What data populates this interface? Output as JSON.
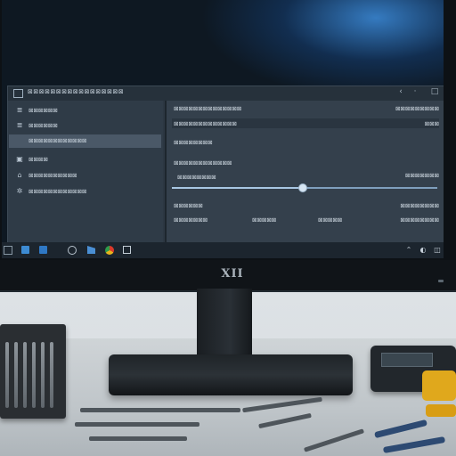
{
  "window": {
    "title": "⊠⊠⊠⊠⊠⊠⊠⊠⊠⊠⊠⊠⊠⊠⊠⊠⊠",
    "controls": [
      "‹",
      "·",
      "□"
    ]
  },
  "sidebar": {
    "items": [
      {
        "icon": "≣",
        "label": "⊠⊠⊠⊠⊠⊠",
        "active": false
      },
      {
        "icon": "≣",
        "label": "⊠⊠⊠⊠⊠⊠",
        "active": false
      },
      {
        "icon": "",
        "label": "⊠⊠⊠⊠⊠⊠⊠⊠⊠⊠⊠⊠",
        "active": true
      },
      {
        "icon": "▣",
        "label": "⊠⊠⊠⊠",
        "active": false
      },
      {
        "icon": "⌂",
        "label": "⊠⊠⊠⊠⊠⊠⊠⊠⊠⊠",
        "active": false
      },
      {
        "icon": "✲",
        "label": "⊠⊠⊠⊠⊠⊠⊠⊠⊠⊠⊠⊠",
        "active": false
      }
    ]
  },
  "content": {
    "heading": "⊠⊠⊠⊠⊠⊠⊠⊠⊠⊠⊠⊠⊠⊠",
    "heading_value": "⊠⊠⊠⊠⊠⊠⊠⊠⊠",
    "row1_label": "⊠⊠⊠⊠⊠⊠⊠⊠⊠⊠⊠⊠⊠",
    "row1_value": "⊠⊠⊠",
    "row2_label": "⊠⊠⊠⊠⊠⊠⊠⊠",
    "row3_label": "⊠⊠⊠⊠⊠⊠⊠⊠⊠⊠⊠⊠",
    "slider_label": "⊠⊠⊠⊠⊠⊠⊠⊠",
    "slider_value_text": "⊠⊠⊠⊠⊠⊠⊠",
    "slider_level": 0.49,
    "bottom1_label": "⊠⊠⊠⊠⊠⊠",
    "bottom1_value": "⊠⊠⊠⊠⊠⊠⊠⊠",
    "bottom2_label": "⊠⊠⊠⊠⊠⊠⊠",
    "bottom2_mid": "⊠⊠⊠⊠⊠",
    "bottom2_mid2": "⊠⊠⊠⊠⊠",
    "bottom2_value": "⊠⊠⊠⊠⊠⊠⊠⊠"
  },
  "taskbar": {
    "apps": [
      "start-icon",
      "explorer-icon",
      "mail-icon",
      "edge-icon",
      "store-icon",
      "chrome-icon",
      "settings-icon"
    ],
    "tray": [
      "⌃",
      "◐",
      "◫"
    ]
  },
  "monitor": {
    "brand": "XII"
  },
  "colors": {
    "accent": "#3f8fd6",
    "window_bg": "#2c3742",
    "sidebar_active": "#4a5867"
  }
}
